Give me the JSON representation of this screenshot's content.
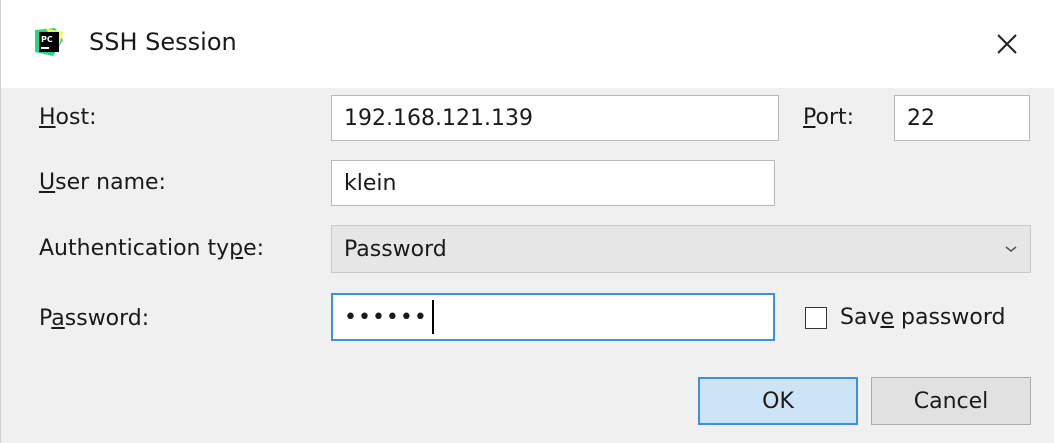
{
  "window": {
    "title": "SSH Session",
    "icon": "pycharm-icon",
    "close_label": "×"
  },
  "form": {
    "host": {
      "label_mnemonic": "H",
      "label_rest": "ost:",
      "value": "192.168.121.139"
    },
    "port": {
      "label_mnemonic": "P",
      "label_rest": "ort:",
      "value": "22"
    },
    "user_name": {
      "label_mnemonic": "U",
      "label_rest": "ser name:",
      "value": "klein"
    },
    "auth_type": {
      "label_pre": "Authentication ty",
      "label_mnemonic": "p",
      "label_rest": "e:",
      "selected": "Password"
    },
    "password": {
      "label_pre": "P",
      "label_mnemonic": "a",
      "label_rest": "ssword:",
      "masked_value": "••••••"
    },
    "save_password": {
      "label_pre": "Sav",
      "label_mnemonic": "e",
      "label_rest": " password",
      "checked": false
    }
  },
  "buttons": {
    "ok": "OK",
    "cancel": "Cancel"
  },
  "colors": {
    "focus": "#3d8fe0",
    "ok_bg": "#cde4f7",
    "dialog_bg": "#f0f0f0"
  }
}
